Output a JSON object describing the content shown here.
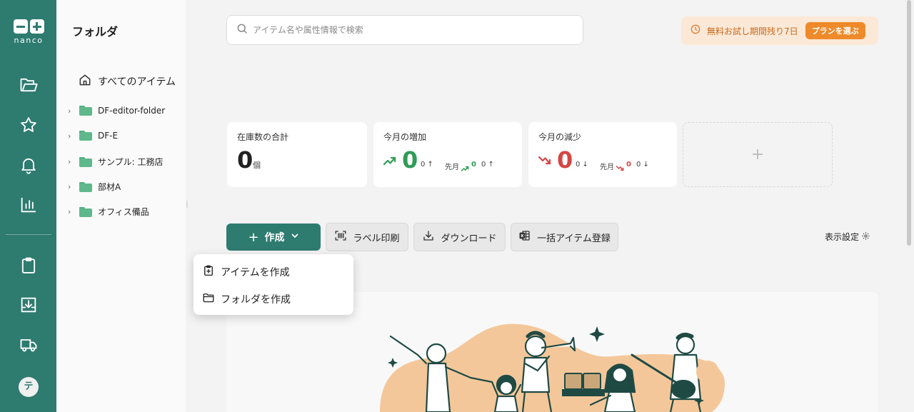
{
  "rail": {
    "logo_text": "nanco",
    "avatar_initial": "テ",
    "icons": [
      "folder-icon",
      "star-icon",
      "bell-icon",
      "chart-icon",
      "clipboard-icon",
      "inbox-download-icon",
      "truck-icon"
    ],
    "accent": "#2e7b70"
  },
  "folders": {
    "title": "フォルダ",
    "all_items": "すべてのアイテム",
    "items": [
      {
        "label": "DF-editor-folder"
      },
      {
        "label": "DF-E"
      },
      {
        "label": "サンプル: 工務店"
      },
      {
        "label": "部材A"
      },
      {
        "label": "オフィス備品"
      }
    ]
  },
  "search": {
    "placeholder": "アイテム名や属性情報で検索"
  },
  "trial": {
    "text": "無料お試し期間残り7日",
    "button": "プランを選ぶ"
  },
  "stats": {
    "total": {
      "label": "在庫数の合計",
      "value": "0",
      "unit": "個"
    },
    "increase": {
      "label": "今月の増加",
      "value": "0",
      "sub": "0 ↑",
      "prev_label": "先月",
      "prev_value": "0",
      "prev_sub": "0 ↑"
    },
    "decrease": {
      "label": "今月の減少",
      "value": "0",
      "sub": "0 ↓",
      "prev_label": "先月",
      "prev_value": "0",
      "prev_sub": "0 ↓"
    },
    "add": "+"
  },
  "toolbar": {
    "create": "作成",
    "label_print": "ラベル印刷",
    "download": "ダウンロード",
    "bulk_register": "一括アイテム登録",
    "display_settings": "表示設定"
  },
  "create_menu": {
    "items": [
      {
        "label": "アイテムを作成"
      },
      {
        "label": "フォルダを作成"
      }
    ]
  }
}
